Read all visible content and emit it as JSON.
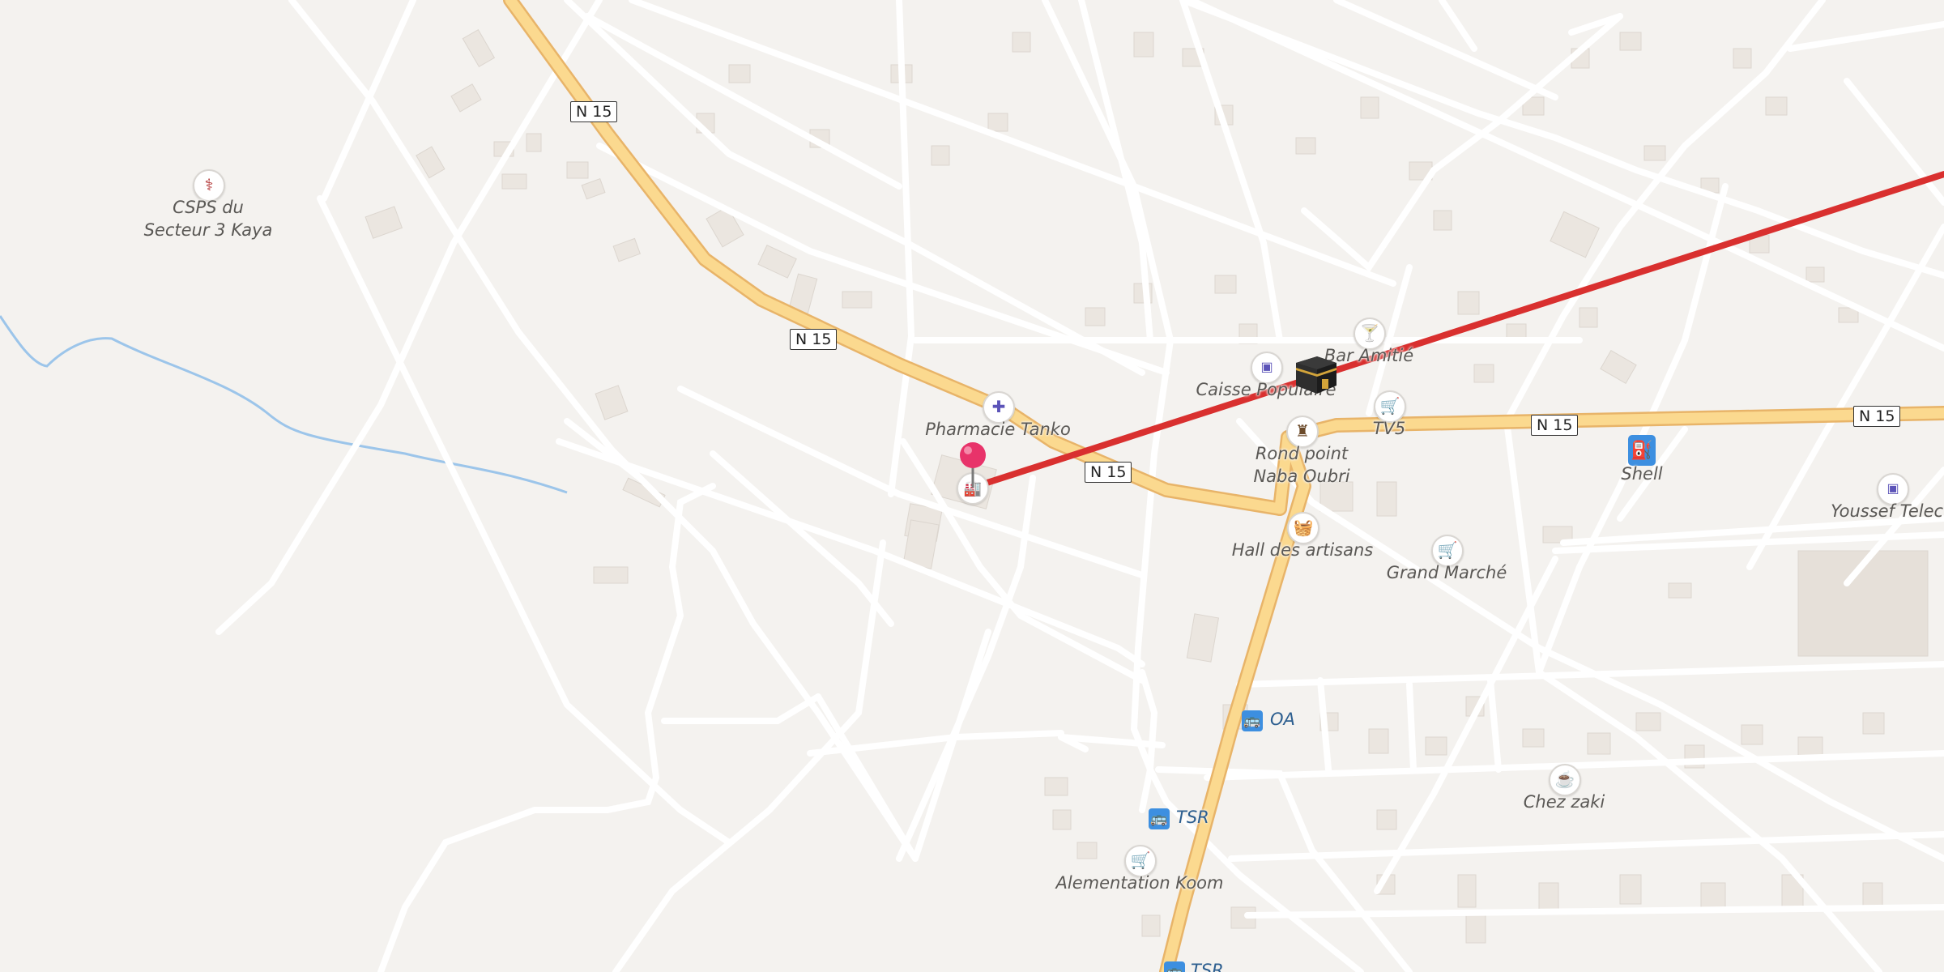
{
  "map": {
    "colors": {
      "background": "#f4f2ef",
      "road_minor": "#ffffff",
      "road_major": "#fbd98f",
      "road_major_casing": "#e8b469",
      "building": "#ebe6e0",
      "water": "#9cc5ea",
      "route": "#d9302f",
      "pin": "#e8336a",
      "poi_icon": "#5b53b8"
    },
    "road_shields": [
      "N 15",
      "N 15",
      "N 15",
      "N 15",
      "N 15"
    ],
    "pois": [
      {
        "name": "CSPS du\nSecteur 3 Kaya",
        "line1": "CSPS du",
        "line2": "Secteur 3 Kaya",
        "icon": "stethoscope-icon"
      },
      {
        "name": "Pharmacie Tanko",
        "icon": "pharmacy-icon"
      },
      {
        "name": "Caisse Populaire",
        "icon": "bank-icon"
      },
      {
        "name": "Bar Amitié",
        "icon": "cocktail-icon"
      },
      {
        "name": "TV5",
        "icon": "cart-icon"
      },
      {
        "name": "Rond point\nNaba Oubri",
        "line1": "Rond point",
        "line2": "Naba Oubri",
        "icon": "monument-icon"
      },
      {
        "name": "Shell",
        "icon": "fuel-icon"
      },
      {
        "name": "Youssef Teleco",
        "icon": "bank-icon"
      },
      {
        "name": "Hall des artisans",
        "icon": "basket-icon"
      },
      {
        "name": "Grand Marché",
        "icon": "cart-icon"
      },
      {
        "name": "Chez zaki",
        "icon": "cafe-icon"
      },
      {
        "name": "Alementation Koom",
        "icon": "cart-icon"
      }
    ],
    "transit": [
      {
        "name": "OA",
        "icon": "bus-icon"
      },
      {
        "name": "TSR",
        "icon": "bus-icon"
      },
      {
        "name": "TSR",
        "icon": "bus-icon"
      }
    ],
    "marker": {
      "icon": "kaaba-icon",
      "pin_icon": "map-pin-icon",
      "place_icon": "factory-icon"
    }
  }
}
